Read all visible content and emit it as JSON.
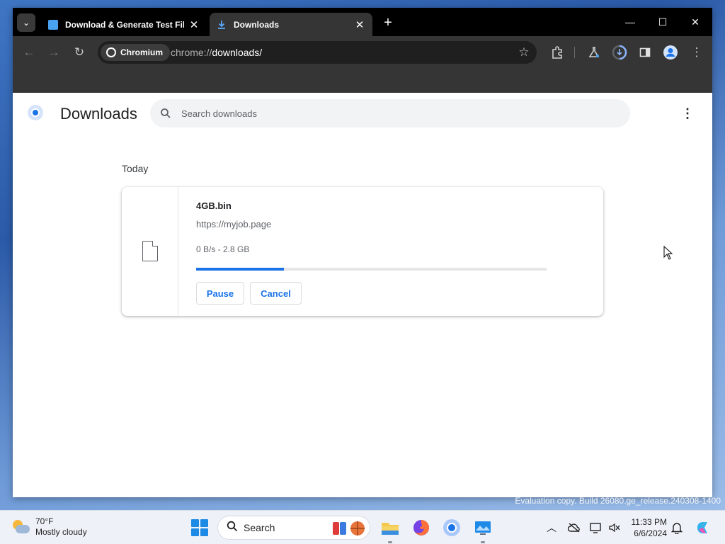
{
  "browser": {
    "tabs": [
      {
        "title": "Download & Generate Test File",
        "icon": "page-icon",
        "active": false
      },
      {
        "title": "Downloads",
        "icon": "download-icon",
        "active": true
      }
    ],
    "new_tab_label": "+",
    "window_controls": {
      "minimize": "—",
      "maximize": "☐",
      "close": "✕"
    },
    "omnibox": {
      "chip_label": "Chromium",
      "url_scheme": "chrome://",
      "url_path": "downloads/"
    }
  },
  "downloads_page": {
    "title": "Downloads",
    "search_placeholder": "Search downloads",
    "section_label": "Today",
    "items": [
      {
        "file_name": "4GB.bin",
        "source_url": "https://myjob.page",
        "status": "0 B/s - 2.8 GB",
        "progress": 0.25,
        "pause_label": "Pause",
        "cancel_label": "Cancel"
      }
    ]
  },
  "desktop": {
    "watermark": "Evaluation copy. Build 26080.ge_release.240308-1400"
  },
  "taskbar": {
    "weather": {
      "temp": "70°F",
      "desc": "Mostly cloudy"
    },
    "search_label": "Search",
    "clock": {
      "time": "11:33 PM",
      "date": "6/6/2024"
    }
  },
  "colors": {
    "accent": "#1a73e8",
    "tabstrip": "#000000",
    "toolbar": "#353535"
  }
}
